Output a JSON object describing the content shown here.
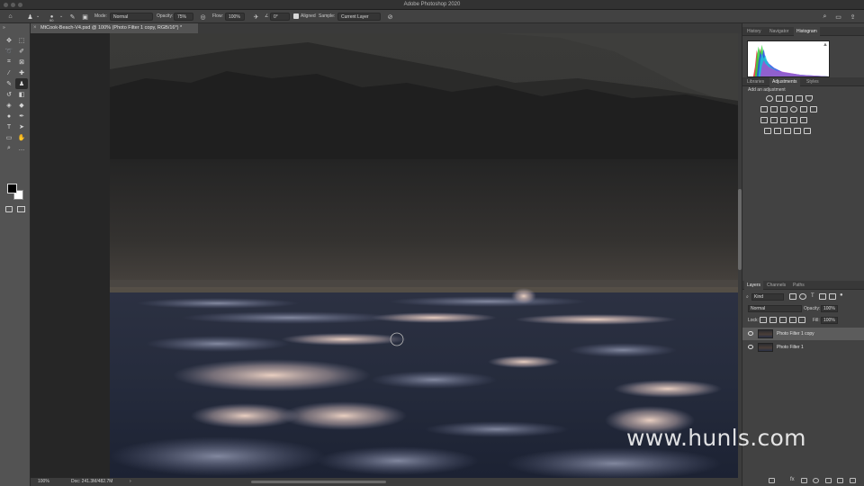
{
  "window": {
    "title": "Adobe Photoshop 2020"
  },
  "options_bar": {
    "brush_size": "90",
    "mode_label": "Mode:",
    "mode_value": "Normal",
    "opacity_label": "Opacity:",
    "opacity_value": "75%",
    "flow_label": "Flow:",
    "flow_value": "100%",
    "angle_value": "0°",
    "aligned_label": "Aligned",
    "sample_label": "Sample:",
    "sample_value": "Current Layer"
  },
  "document": {
    "tab_label": "MtCook-Beach-V4.psd @ 100% (Photo Filter 1 copy, RGB/16*) *",
    "zoom": "100%",
    "doc_info": "Doc: 241.3M/482.7M"
  },
  "panels": {
    "top_tabs": [
      "History",
      "Navigator",
      "Histogram"
    ],
    "mid_tabs": [
      "Libraries",
      "Adjustments",
      "Styles"
    ],
    "adjustment_hint": "Add an adjustment",
    "layers_tabs": [
      "Layers",
      "Channels",
      "Paths"
    ]
  },
  "layers_panel": {
    "filter_kind": "Kind",
    "blend_mode": "Normal",
    "opacity_label": "Opacity:",
    "opacity_value": "100%",
    "lock_label": "Lock:",
    "fill_label": "Fill:",
    "fill_value": "100%",
    "layers": [
      {
        "name": "Photo Filter 1 copy",
        "selected": true
      },
      {
        "name": "Photo Filter 1",
        "selected": false
      }
    ]
  },
  "watermark": {
    "text": "www.hunls.com"
  },
  "colors": {
    "app_bg": "#535353",
    "panel_bg": "#424242",
    "titlebar_bg": "#323232",
    "canvas_bg": "#1c1c1c",
    "foreground_swatch": "#000000",
    "background_swatch": "#ffffff"
  },
  "icons": {
    "toolbar": [
      "home-icon",
      "clone-stamp-icon",
      "brush-preset-icon",
      "brush-settings-icon",
      "airbrush-icon",
      "pressure-icon",
      "search-icon",
      "workspace-icon",
      "share-icon"
    ]
  }
}
